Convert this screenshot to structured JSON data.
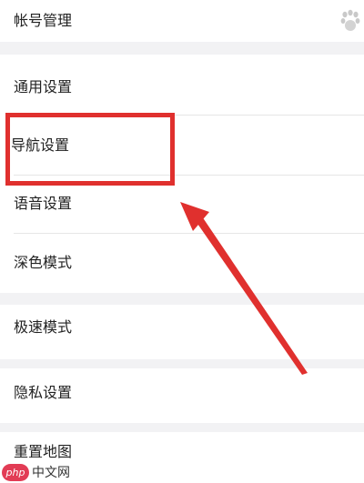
{
  "settings": {
    "items": [
      {
        "label": "帐号管理"
      },
      {
        "label": "通用设置"
      },
      {
        "label": "导航设置"
      },
      {
        "label": "语音设置"
      },
      {
        "label": "深色模式"
      },
      {
        "label": "极速模式"
      },
      {
        "label": "隐私设置"
      },
      {
        "label": "重置地图"
      }
    ]
  },
  "icons": {
    "account_corner": "paw-icon"
  },
  "annotation": {
    "highlight_color": "#e0302e",
    "highlighted_item": "导航设置"
  },
  "watermark": {
    "badge": "php",
    "text": "中文网"
  }
}
